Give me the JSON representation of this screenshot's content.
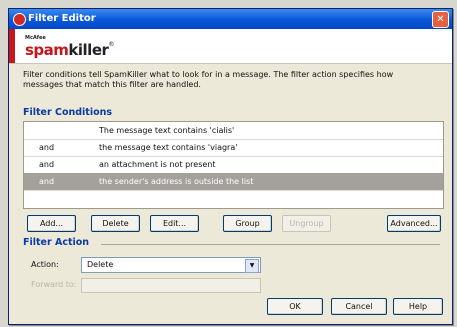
{
  "window": {
    "title": "Filter Editor",
    "close_glyph": "✕"
  },
  "banner": {
    "brand_small": "McAfee",
    "logo_spam": "spam",
    "logo_killer": "killer",
    "logo_tm": "®"
  },
  "intro_text": "Filter conditions tell SpamKiller what to look for in a message. The filter action specifies how messages that match this filter are handled.",
  "filter_conditions": {
    "heading": "Filter Conditions",
    "rows": [
      {
        "conj": "",
        "text": "The message text contains 'cialis'",
        "selected": false
      },
      {
        "conj": "and",
        "text": "the message text contains 'viagra'",
        "selected": false
      },
      {
        "conj": "and",
        "text": "an attachment is not present",
        "selected": false
      },
      {
        "conj": "and",
        "text": "the sender's address is outside the list",
        "selected": true
      }
    ]
  },
  "buttons": {
    "add": "Add...",
    "delete": "Delete",
    "edit": "Edit...",
    "group": "Group",
    "ungroup": "Ungroup",
    "advanced": "Advanced..."
  },
  "filter_action": {
    "heading": "Filter Action",
    "action_label": "Action:",
    "action_value": "Delete",
    "dropdown_glyph": "▼",
    "secondary_label": "Forward to:"
  },
  "footer": {
    "ok": "OK",
    "cancel": "Cancel",
    "help": "Help"
  }
}
